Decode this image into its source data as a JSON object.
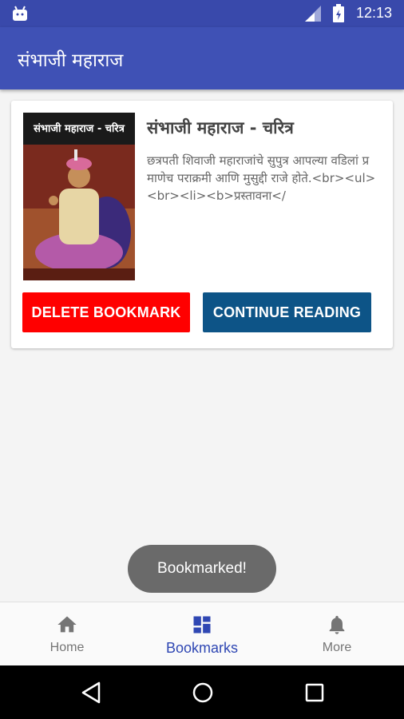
{
  "status_bar": {
    "time": "12:13"
  },
  "app_bar": {
    "title": "संभाजी महाराज"
  },
  "card": {
    "cover_text": "संभाजी महाराज - चरित्र",
    "title": "संभाजी महाराज - चरित्र",
    "description": "छत्रपती शिवाजी महाराजांचे सुपुत्र आपल्या वडिलां प्रमाणेच पराक्रमी आणि मुसुद्दी राजे होते.<br><ul><br><li><b>प्रस्तावना</",
    "delete_label": "DELETE BOOKMARK",
    "continue_label": "CONTINUE READING"
  },
  "toast": {
    "text": "Bookmarked!"
  },
  "bottom_nav": {
    "items": [
      {
        "label": "Home",
        "icon": "home-icon",
        "active": false
      },
      {
        "label": "Bookmarks",
        "icon": "dashboard-icon",
        "active": true
      },
      {
        "label": "More",
        "icon": "bell-icon",
        "active": false
      }
    ]
  },
  "colors": {
    "primary": "#3f51b5",
    "status_bar": "#3949ab",
    "delete_button": "#ff0000",
    "continue_button": "#0d5487",
    "nav_active": "#2f47b3",
    "nav_inactive": "#757575"
  }
}
